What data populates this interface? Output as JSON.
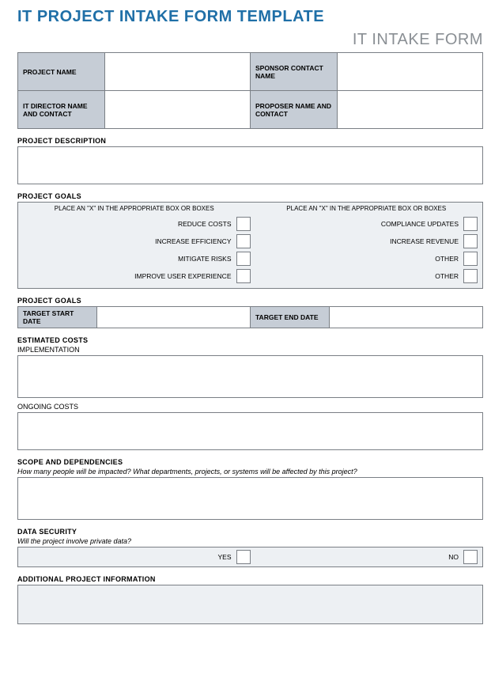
{
  "pageTitle": "IT PROJECT INTAKE FORM TEMPLATE",
  "subtitle": "IT INTAKE FORM",
  "header": {
    "projectNameLabel": "PROJECT NAME",
    "projectNameValue": "",
    "sponsorLabel": "SPONSOR CONTACT NAME",
    "sponsorValue": "",
    "directorLabel": "IT DIRECTOR NAME AND CONTACT",
    "directorValue": "",
    "proposerLabel": "PROPOSER NAME AND CONTACT",
    "proposerValue": ""
  },
  "sections": {
    "descriptionTitle": "PROJECT DESCRIPTION",
    "descriptionValue": "",
    "goalsTitle": "PROJECT GOALS",
    "goalsInstruction": "PLACE AN \"X\" IN THE APPROPRIATE BOX OR BOXES",
    "goalsLeft": [
      "REDUCE COSTS",
      "INCREASE EFFICIENCY",
      "MITIGATE RISKS",
      "IMPROVE USER EXPERIENCE"
    ],
    "goalsRight": [
      "COMPLIANCE UPDATES",
      "INCREASE REVENUE",
      "OTHER",
      "OTHER"
    ],
    "datesTitle": "PROJECT GOALS",
    "startLabel": "TARGET START DATE",
    "startValue": "",
    "endLabel": "TARGET END DATE",
    "endValue": "",
    "costsTitle": "ESTIMATED COSTS",
    "implLabel": "IMPLEMENTATION",
    "implValue": "",
    "ongoingLabel": "ONGOING COSTS",
    "ongoingValue": "",
    "scopeTitle": "SCOPE AND DEPENDENCIES",
    "scopeSub": "How many people will be impacted? What departments, projects, or systems will be affected by this project?",
    "scopeValue": "",
    "securityTitle": "DATA SECURITY",
    "securitySub": "Will the project involve private data?",
    "yesLabel": "YES",
    "noLabel": "NO",
    "additionalTitle": "ADDITIONAL PROJECT INFORMATION",
    "additionalValue": ""
  }
}
